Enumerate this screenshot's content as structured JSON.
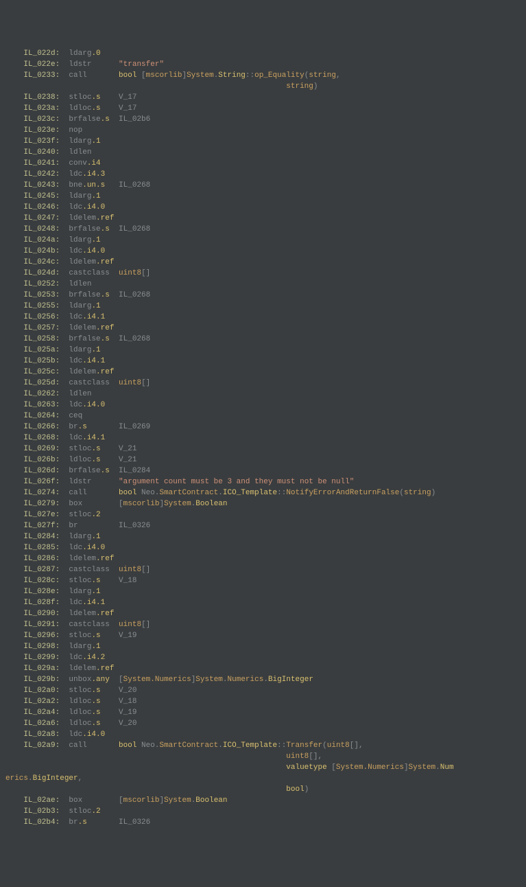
{
  "lines": [
    {
      "kind": "instr",
      "offset": "IL_022d",
      "op": "ldarg",
      "suffix": ".0"
    },
    {
      "kind": "instr",
      "offset": "IL_022e",
      "op": "ldstr",
      "args": [
        {
          "cls": "t-str",
          "text": "\"transfer\""
        }
      ]
    },
    {
      "kind": "instr",
      "offset": "IL_0233",
      "op": "call",
      "args": [
        {
          "cls": "t-kw",
          "text": "bool"
        },
        {
          "cls": "t-op",
          "text": " ["
        },
        {
          "cls": "t-ns",
          "text": "mscorlib"
        },
        {
          "cls": "t-op",
          "text": "]"
        },
        {
          "cls": "t-ns",
          "text": "System"
        },
        {
          "cls": "t-op",
          "text": "."
        },
        {
          "cls": "t-type",
          "text": "String"
        },
        {
          "cls": "t-op",
          "text": "::"
        },
        {
          "cls": "t-member",
          "text": "op_Equality"
        },
        {
          "cls": "t-op",
          "text": "("
        },
        {
          "cls": "t-ptype",
          "text": "string"
        },
        {
          "cls": "t-op",
          "text": ","
        }
      ]
    },
    {
      "kind": "cont",
      "text": "                                                              ",
      "args": [
        {
          "cls": "t-ptype",
          "text": "string"
        },
        {
          "cls": "t-op",
          "text": ")"
        }
      ]
    },
    {
      "kind": "instr",
      "offset": "IL_0238",
      "op": "stloc",
      "suffix": ".s",
      "args": [
        {
          "cls": "t-op",
          "text": "V_17"
        }
      ]
    },
    {
      "kind": "instr",
      "offset": "IL_023a",
      "op": "ldloc",
      "suffix": ".s",
      "args": [
        {
          "cls": "t-op",
          "text": "V_17"
        }
      ]
    },
    {
      "kind": "instr",
      "offset": "IL_023c",
      "op": "brfalse",
      "suffix": ".s",
      "args": [
        {
          "cls": "t-op",
          "text": "IL_02b6"
        }
      ]
    },
    {
      "kind": "instr",
      "offset": "IL_023e",
      "op": "nop"
    },
    {
      "kind": "instr",
      "offset": "IL_023f",
      "op": "ldarg",
      "suffix": ".1"
    },
    {
      "kind": "instr",
      "offset": "IL_0240",
      "op": "ldlen"
    },
    {
      "kind": "instr",
      "offset": "IL_0241",
      "op": "conv",
      "suffix": ".i4"
    },
    {
      "kind": "instr",
      "offset": "IL_0242",
      "op": "ldc",
      "suffix": ".i4.3"
    },
    {
      "kind": "instr",
      "offset": "IL_0243",
      "op": "bne",
      "suffix": ".un.s",
      "args": [
        {
          "cls": "t-op",
          "text": "IL_0268"
        }
      ]
    },
    {
      "kind": "instr",
      "offset": "IL_0245",
      "op": "ldarg",
      "suffix": ".1"
    },
    {
      "kind": "instr",
      "offset": "IL_0246",
      "op": "ldc",
      "suffix": ".i4.0"
    },
    {
      "kind": "instr",
      "offset": "IL_0247",
      "op": "ldelem",
      "suffix": ".ref"
    },
    {
      "kind": "instr",
      "offset": "IL_0248",
      "op": "brfalse",
      "suffix": ".s",
      "args": [
        {
          "cls": "t-op",
          "text": "IL_0268"
        }
      ]
    },
    {
      "kind": "instr",
      "offset": "IL_024a",
      "op": "ldarg",
      "suffix": ".1"
    },
    {
      "kind": "instr",
      "offset": "IL_024b",
      "op": "ldc",
      "suffix": ".i4.0"
    },
    {
      "kind": "instr",
      "offset": "IL_024c",
      "op": "ldelem",
      "suffix": ".ref"
    },
    {
      "kind": "instr",
      "offset": "IL_024d",
      "op": "castclass",
      "args": [
        {
          "cls": "t-ptype",
          "text": "uint8"
        },
        {
          "cls": "t-op",
          "text": "[]"
        }
      ]
    },
    {
      "kind": "instr",
      "offset": "IL_0252",
      "op": "ldlen"
    },
    {
      "kind": "instr",
      "offset": "IL_0253",
      "op": "brfalse",
      "suffix": ".s",
      "args": [
        {
          "cls": "t-op",
          "text": "IL_0268"
        }
      ]
    },
    {
      "kind": "instr",
      "offset": "IL_0255",
      "op": "ldarg",
      "suffix": ".1"
    },
    {
      "kind": "instr",
      "offset": "IL_0256",
      "op": "ldc",
      "suffix": ".i4.1"
    },
    {
      "kind": "instr",
      "offset": "IL_0257",
      "op": "ldelem",
      "suffix": ".ref"
    },
    {
      "kind": "instr",
      "offset": "IL_0258",
      "op": "brfalse",
      "suffix": ".s",
      "args": [
        {
          "cls": "t-op",
          "text": "IL_0268"
        }
      ]
    },
    {
      "kind": "instr",
      "offset": "IL_025a",
      "op": "ldarg",
      "suffix": ".1"
    },
    {
      "kind": "instr",
      "offset": "IL_025b",
      "op": "ldc",
      "suffix": ".i4.1"
    },
    {
      "kind": "instr",
      "offset": "IL_025c",
      "op": "ldelem",
      "suffix": ".ref"
    },
    {
      "kind": "instr",
      "offset": "IL_025d",
      "op": "castclass",
      "args": [
        {
          "cls": "t-ptype",
          "text": "uint8"
        },
        {
          "cls": "t-op",
          "text": "[]"
        }
      ]
    },
    {
      "kind": "instr",
      "offset": "IL_0262",
      "op": "ldlen"
    },
    {
      "kind": "instr",
      "offset": "IL_0263",
      "op": "ldc",
      "suffix": ".i4.0"
    },
    {
      "kind": "instr",
      "offset": "IL_0264",
      "op": "ceq"
    },
    {
      "kind": "instr",
      "offset": "IL_0266",
      "op": "br",
      "suffix": ".s",
      "args": [
        {
          "cls": "t-op",
          "text": "IL_0269"
        }
      ]
    },
    {
      "kind": "instr",
      "offset": "IL_0268",
      "op": "ldc",
      "suffix": ".i4.1"
    },
    {
      "kind": "instr",
      "offset": "IL_0269",
      "op": "stloc",
      "suffix": ".s",
      "args": [
        {
          "cls": "t-op",
          "text": "V_21"
        }
      ]
    },
    {
      "kind": "instr",
      "offset": "IL_026b",
      "op": "ldloc",
      "suffix": ".s",
      "args": [
        {
          "cls": "t-op",
          "text": "V_21"
        }
      ]
    },
    {
      "kind": "instr",
      "offset": "IL_026d",
      "op": "brfalse",
      "suffix": ".s",
      "args": [
        {
          "cls": "t-op",
          "text": "IL_0284"
        }
      ]
    },
    {
      "kind": "instr",
      "offset": "IL_026f",
      "op": "ldstr",
      "args": [
        {
          "cls": "t-str",
          "text": "\"argument count must be 3 and they must not be null\""
        }
      ]
    },
    {
      "kind": "instr",
      "offset": "IL_0274",
      "op": "call",
      "args": [
        {
          "cls": "t-kw",
          "text": "bool"
        },
        {
          "cls": "t-op",
          "text": " Neo"
        },
        {
          "cls": "t-op",
          "text": "."
        },
        {
          "cls": "t-ns",
          "text": "SmartContract"
        },
        {
          "cls": "t-op",
          "text": "."
        },
        {
          "cls": "t-type",
          "text": "ICO_Template"
        },
        {
          "cls": "t-op",
          "text": "::"
        },
        {
          "cls": "t-member",
          "text": "NotifyErrorAndReturnFalse"
        },
        {
          "cls": "t-op",
          "text": "("
        },
        {
          "cls": "t-ptype",
          "text": "string"
        },
        {
          "cls": "t-op",
          "text": ")"
        }
      ]
    },
    {
      "kind": "instr",
      "offset": "IL_0279",
      "op": "box",
      "args": [
        {
          "cls": "t-op",
          "text": "["
        },
        {
          "cls": "t-ns",
          "text": "mscorlib"
        },
        {
          "cls": "t-op",
          "text": "]"
        },
        {
          "cls": "t-ns",
          "text": "System"
        },
        {
          "cls": "t-op",
          "text": "."
        },
        {
          "cls": "t-type",
          "text": "Boolean"
        }
      ]
    },
    {
      "kind": "instr",
      "offset": "IL_027e",
      "op": "stloc",
      "suffix": ".2"
    },
    {
      "kind": "instr",
      "offset": "IL_027f",
      "op": "br",
      "args": [
        {
          "cls": "t-op",
          "text": "IL_0326"
        }
      ]
    },
    {
      "kind": "instr",
      "offset": "IL_0284",
      "op": "ldarg",
      "suffix": ".1"
    },
    {
      "kind": "instr",
      "offset": "IL_0285",
      "op": "ldc",
      "suffix": ".i4.0"
    },
    {
      "kind": "instr",
      "offset": "IL_0286",
      "op": "ldelem",
      "suffix": ".ref"
    },
    {
      "kind": "instr",
      "offset": "IL_0287",
      "op": "castclass",
      "args": [
        {
          "cls": "t-ptype",
          "text": "uint8"
        },
        {
          "cls": "t-op",
          "text": "[]"
        }
      ]
    },
    {
      "kind": "instr",
      "offset": "IL_028c",
      "op": "stloc",
      "suffix": ".s",
      "args": [
        {
          "cls": "t-op",
          "text": "V_18"
        }
      ]
    },
    {
      "kind": "instr",
      "offset": "IL_028e",
      "op": "ldarg",
      "suffix": ".1"
    },
    {
      "kind": "instr",
      "offset": "IL_028f",
      "op": "ldc",
      "suffix": ".i4.1"
    },
    {
      "kind": "instr",
      "offset": "IL_0290",
      "op": "ldelem",
      "suffix": ".ref"
    },
    {
      "kind": "instr",
      "offset": "IL_0291",
      "op": "castclass",
      "args": [
        {
          "cls": "t-ptype",
          "text": "uint8"
        },
        {
          "cls": "t-op",
          "text": "[]"
        }
      ]
    },
    {
      "kind": "instr",
      "offset": "IL_0296",
      "op": "stloc",
      "suffix": ".s",
      "args": [
        {
          "cls": "t-op",
          "text": "V_19"
        }
      ]
    },
    {
      "kind": "instr",
      "offset": "IL_0298",
      "op": "ldarg",
      "suffix": ".1"
    },
    {
      "kind": "instr",
      "offset": "IL_0299",
      "op": "ldc",
      "suffix": ".i4.2"
    },
    {
      "kind": "instr",
      "offset": "IL_029a",
      "op": "ldelem",
      "suffix": ".ref"
    },
    {
      "kind": "instr",
      "offset": "IL_029b",
      "op": "unbox",
      "suffix": ".any",
      "args": [
        {
          "cls": "t-op",
          "text": "["
        },
        {
          "cls": "t-ns",
          "text": "System.Numerics"
        },
        {
          "cls": "t-op",
          "text": "]"
        },
        {
          "cls": "t-ns",
          "text": "System"
        },
        {
          "cls": "t-op",
          "text": "."
        },
        {
          "cls": "t-ns",
          "text": "Numerics"
        },
        {
          "cls": "t-op",
          "text": "."
        },
        {
          "cls": "t-type",
          "text": "BigInteger"
        }
      ]
    },
    {
      "kind": "instr",
      "offset": "IL_02a0",
      "op": "stloc",
      "suffix": ".s",
      "args": [
        {
          "cls": "t-op",
          "text": "V_20"
        }
      ]
    },
    {
      "kind": "instr",
      "offset": "IL_02a2",
      "op": "ldloc",
      "suffix": ".s",
      "args": [
        {
          "cls": "t-op",
          "text": "V_18"
        }
      ]
    },
    {
      "kind": "instr",
      "offset": "IL_02a4",
      "op": "ldloc",
      "suffix": ".s",
      "args": [
        {
          "cls": "t-op",
          "text": "V_19"
        }
      ]
    },
    {
      "kind": "instr",
      "offset": "IL_02a6",
      "op": "ldloc",
      "suffix": ".s",
      "args": [
        {
          "cls": "t-op",
          "text": "V_20"
        }
      ]
    },
    {
      "kind": "instr",
      "offset": "IL_02a8",
      "op": "ldc",
      "suffix": ".i4.0"
    },
    {
      "kind": "instr",
      "offset": "IL_02a9",
      "op": "call",
      "args": [
        {
          "cls": "t-kw",
          "text": "bool"
        },
        {
          "cls": "t-op",
          "text": " Neo"
        },
        {
          "cls": "t-op",
          "text": "."
        },
        {
          "cls": "t-ns",
          "text": "SmartContract"
        },
        {
          "cls": "t-op",
          "text": "."
        },
        {
          "cls": "t-type",
          "text": "ICO_Template"
        },
        {
          "cls": "t-op",
          "text": "::"
        },
        {
          "cls": "t-member",
          "text": "Transfer"
        },
        {
          "cls": "t-op",
          "text": "("
        },
        {
          "cls": "t-ptype",
          "text": "uint8"
        },
        {
          "cls": "t-op",
          "text": "[],"
        }
      ]
    },
    {
      "kind": "cont",
      "text": "                                                              ",
      "args": [
        {
          "cls": "t-ptype",
          "text": "uint8"
        },
        {
          "cls": "t-op",
          "text": "[],"
        }
      ]
    },
    {
      "kind": "cont",
      "text": "                                                              ",
      "args": [
        {
          "cls": "t-kw",
          "text": "valuetype"
        },
        {
          "cls": "t-op",
          "text": " ["
        },
        {
          "cls": "t-ns",
          "text": "System.Numerics"
        },
        {
          "cls": "t-op",
          "text": "]"
        },
        {
          "cls": "t-ns",
          "text": "System"
        },
        {
          "cls": "t-op",
          "text": "."
        },
        {
          "cls": "t-type",
          "text": "Num"
        }
      ]
    },
    {
      "kind": "wrap",
      "args": [
        {
          "cls": "t-ns",
          "text": "erics"
        },
        {
          "cls": "t-op",
          "text": "."
        },
        {
          "cls": "t-type",
          "text": "BigInteger"
        },
        {
          "cls": "t-op",
          "text": ","
        }
      ]
    },
    {
      "kind": "cont",
      "text": "                                                              ",
      "args": [
        {
          "cls": "t-kw",
          "text": "bool"
        },
        {
          "cls": "t-op",
          "text": ")"
        }
      ]
    },
    {
      "kind": "instr",
      "offset": "IL_02ae",
      "op": "box",
      "args": [
        {
          "cls": "t-op",
          "text": "["
        },
        {
          "cls": "t-ns",
          "text": "mscorlib"
        },
        {
          "cls": "t-op",
          "text": "]"
        },
        {
          "cls": "t-ns",
          "text": "System"
        },
        {
          "cls": "t-op",
          "text": "."
        },
        {
          "cls": "t-type",
          "text": "Boolean"
        }
      ]
    },
    {
      "kind": "instr",
      "offset": "IL_02b3",
      "op": "stloc",
      "suffix": ".2"
    },
    {
      "kind": "instr",
      "offset": "IL_02b4",
      "op": "br",
      "suffix": ".s",
      "args": [
        {
          "cls": "t-op",
          "text": "IL_0326"
        }
      ]
    }
  ]
}
